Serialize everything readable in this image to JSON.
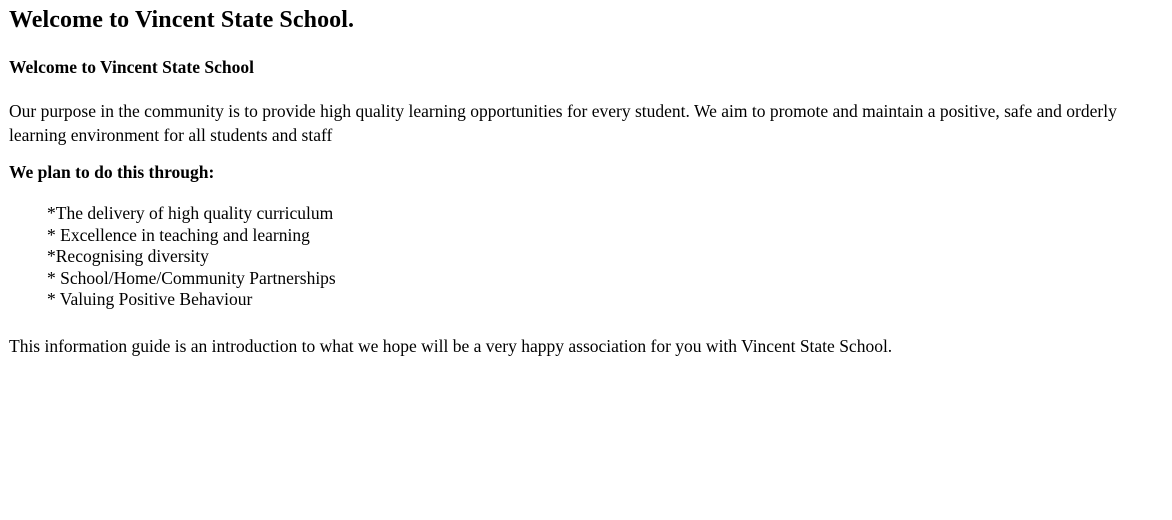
{
  "page": {
    "main_title": "Welcome to Vincent State School.",
    "sub_title": "Welcome to Vincent State School",
    "intro": "Our purpose in the community is to provide high quality learning opportunities for every student. We aim to promote and maintain a positive, safe and orderly learning environment for all students and staff",
    "plan_heading": "We plan to do this through:",
    "plan_items": [
      "*The delivery of high quality curriculum",
      "* Excellence in teaching and learning",
      "*Recognising diversity",
      "* School/Home/Community Partnerships",
      "* Valuing Positive Behaviour"
    ],
    "closing": "This information guide is an introduction to what we hope will be a very happy association for you with Vincent State School."
  }
}
